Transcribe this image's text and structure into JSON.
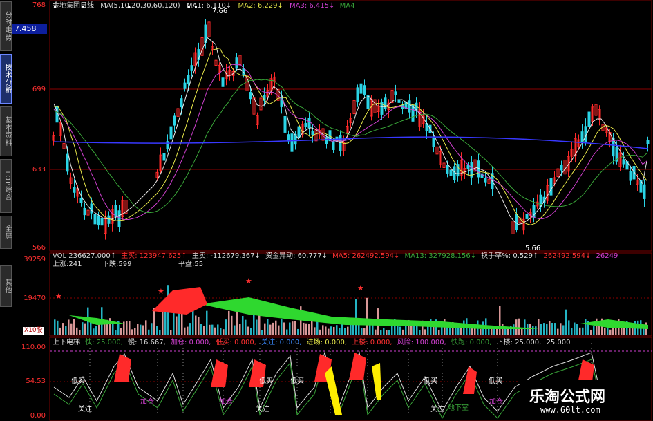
{
  "sidebar": {
    "tabs": [
      {
        "label": "分时走势",
        "active": false
      },
      {
        "label": "技术分析",
        "active": true
      },
      {
        "label": "基本资料",
        "active": false
      },
      {
        "label": "TOP综合",
        "active": false
      },
      {
        "label": "全屏",
        "active": false
      },
      {
        "label": "其他",
        "active": false
      }
    ]
  },
  "header": {
    "stock": "金地集团",
    "period": "日线",
    "ma_params": "MA(5,10,20,30,60,120)",
    "ma1": "MA1: 6.110↓",
    "ma2": "MA2: 6.229↓",
    "ma3": "MA3: 6.415↓",
    "ma4": "MA4"
  },
  "price_axis": {
    "labels": [
      "768",
      "699",
      "633",
      "566"
    ],
    "current": "7.458"
  },
  "price_annotations": {
    "high": "7.66",
    "low": "5.66"
  },
  "volume_header": {
    "vol": "VOL 236627.000↑",
    "zhumai": "主买: 123947.625↑",
    "zhumai_sell": "主卖: -112679.367↓",
    "capital": "资金异动: 60.777↓",
    "ma5": "MA5: 262492.594↓",
    "ma13": "MA13: 327928.156↓",
    "turnover": "换手率%: 0.529↑",
    "x1": "262492.594↓",
    "x2": "26249"
  },
  "volume_sub": {
    "up": "上涨:241",
    "down": "下跌:599",
    "flat": "平盘:55"
  },
  "volume_axis": {
    "labels": [
      "39259",
      "19470"
    ],
    "unit": "X10股"
  },
  "indicator_header": {
    "name": "上下电梯",
    "fast": "快: 25.000,",
    "slow": "慢: 16.667,",
    "add": "加仓: 0.000,",
    "low_buy": "低买: 0.000,",
    "follow": "关注: 0.000,",
    "enter": "进场: 0.000,",
    "up": "上楼: 0.000,",
    "risk": "风险: 100.000,",
    "bounce": "快跑: 0.000,",
    "down": "下楼: 25.000,",
    "tail": "25.000"
  },
  "indicator_axis": {
    "labels": [
      "110.00",
      "54.53",
      "0.00"
    ]
  },
  "indicator_labels": {
    "dibuy": "低买",
    "follow": "关注",
    "add": "加仓",
    "floor": "地下室"
  },
  "watermark": {
    "title": "乐淘公式网",
    "url": "www.60lt.com"
  },
  "colors": {
    "up": "#ff2a2a",
    "down": "#2ad4e6",
    "ma_white": "#e8e8e8",
    "ma_yellow": "#e8e84a",
    "ma_magenta": "#d040d0",
    "ma_green": "#3aa83a",
    "ma_blue": "#3838ff",
    "grid": "#8b0000"
  }
}
